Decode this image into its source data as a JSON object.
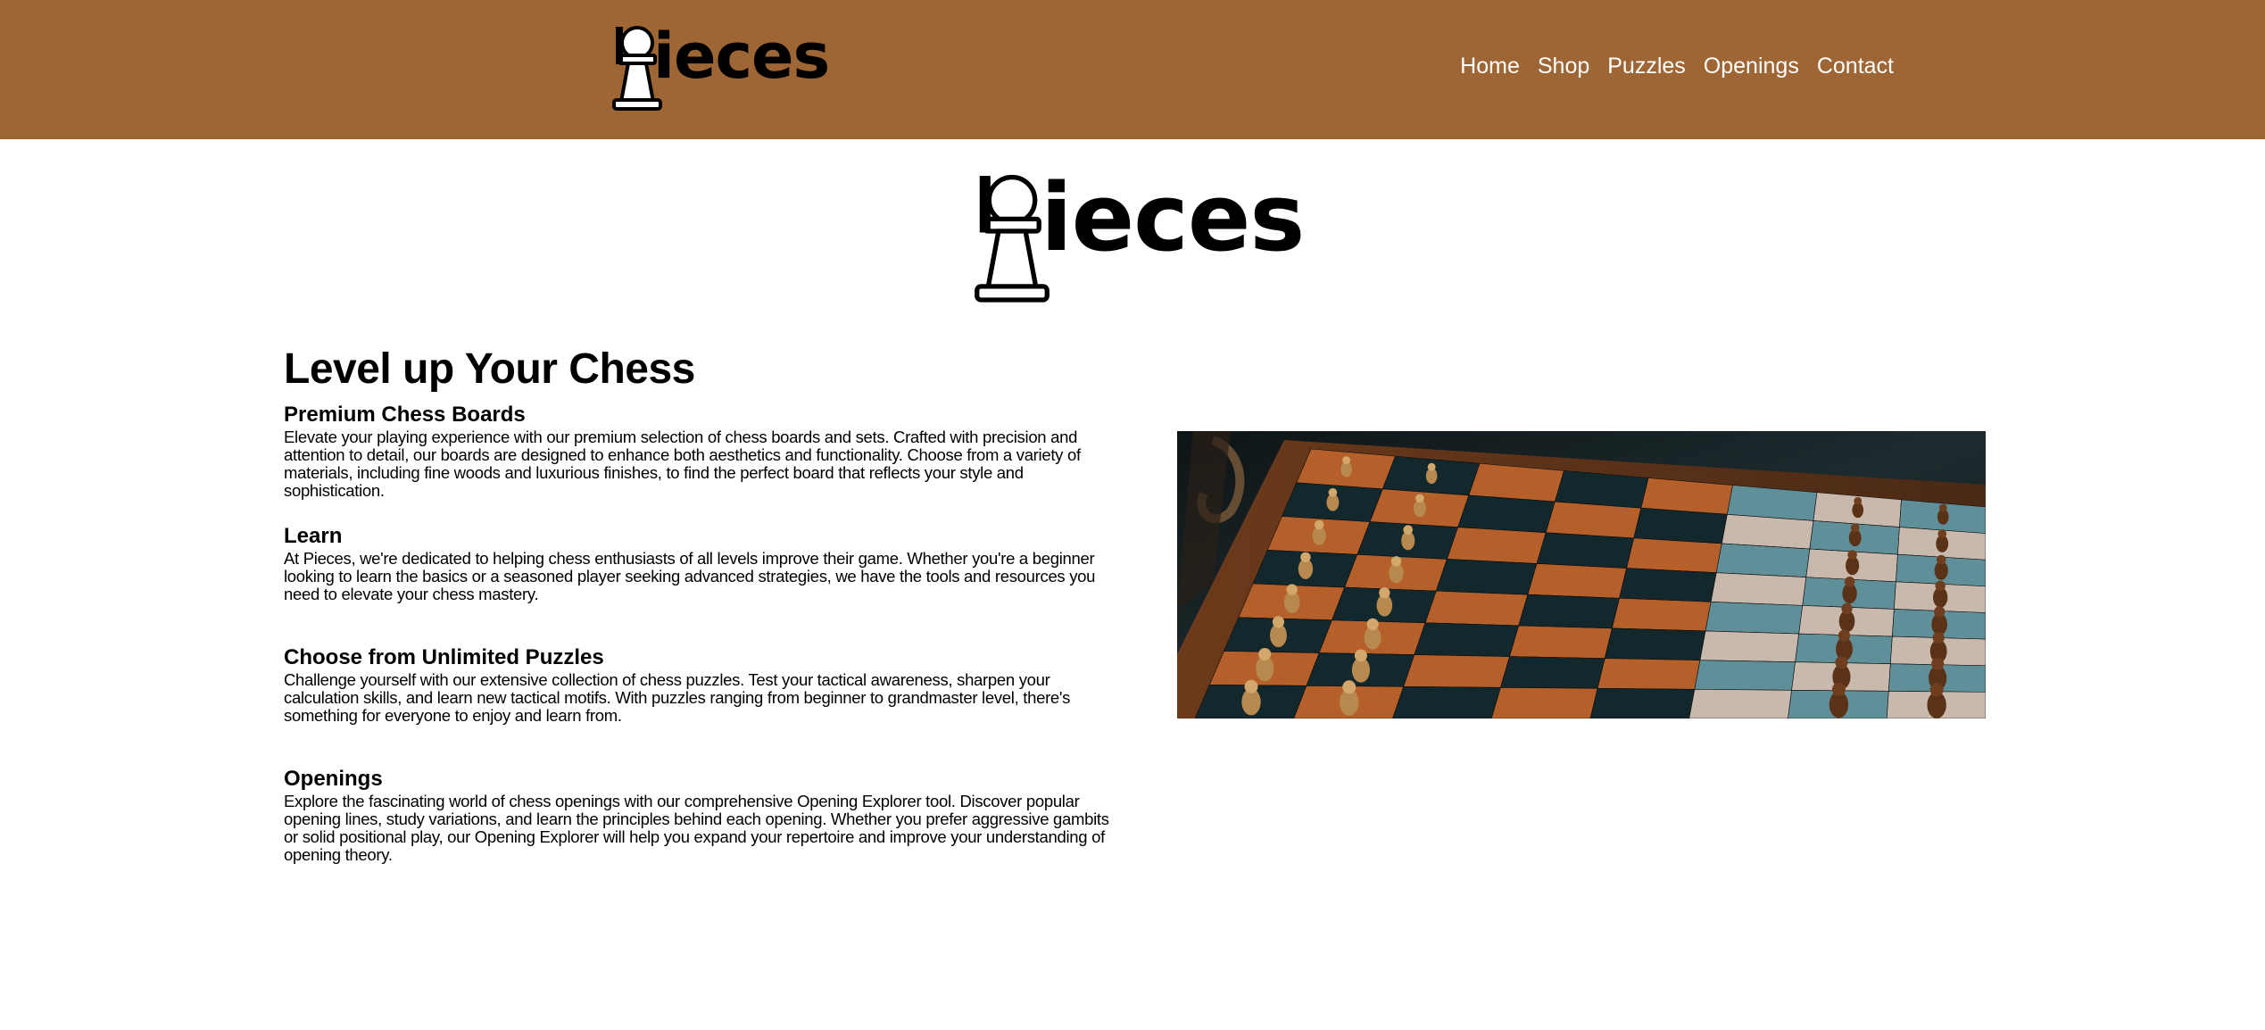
{
  "header": {
    "logo_text": "ieces",
    "nav": [
      "Home",
      "Shop",
      "Puzzles",
      "Openings",
      "Contact"
    ]
  },
  "hero": {
    "logo_text": "ieces"
  },
  "content": {
    "title": "Level up Your Chess",
    "sections": [
      {
        "heading": "Premium Chess Boards",
        "body": "Elevate your playing experience with our premium selection of chess boards and sets. Crafted with precision and attention to detail, our boards are designed to enhance both aesthetics and functionality. Choose from a variety of materials, including fine woods and luxurious finishes, to find the perfect board that reflects your style and sophistication."
      },
      {
        "heading": "Learn",
        "body": "At Pieces, we're dedicated to helping chess enthusiasts of all levels improve their game. Whether you're a beginner looking to learn the basics or a seasoned player seeking advanced strategies, we have the tools and resources you need to elevate your chess mastery."
      },
      {
        "heading": "Choose from Unlimited Puzzles",
        "body": "Challenge yourself with our extensive collection of chess puzzles. Test your tactical awareness, sharpen your calculation skills, and learn new tactical motifs. With puzzles ranging from beginner to grandmaster level, there's something for everyone to enjoy and learn from."
      },
      {
        "heading": "Openings",
        "body": "Explore the fascinating world of chess openings with our comprehensive Opening Explorer tool. Discover popular opening lines, study variations, and learn the principles behind each opening. Whether you prefer aggressive gambits or solid positional play, our Opening Explorer will help you expand your repertoire and improve your understanding of opening theory."
      }
    ]
  },
  "colors": {
    "header_bg": "#9e6535",
    "nav_text": "#ffffff",
    "page_bg": "#ffffff"
  }
}
